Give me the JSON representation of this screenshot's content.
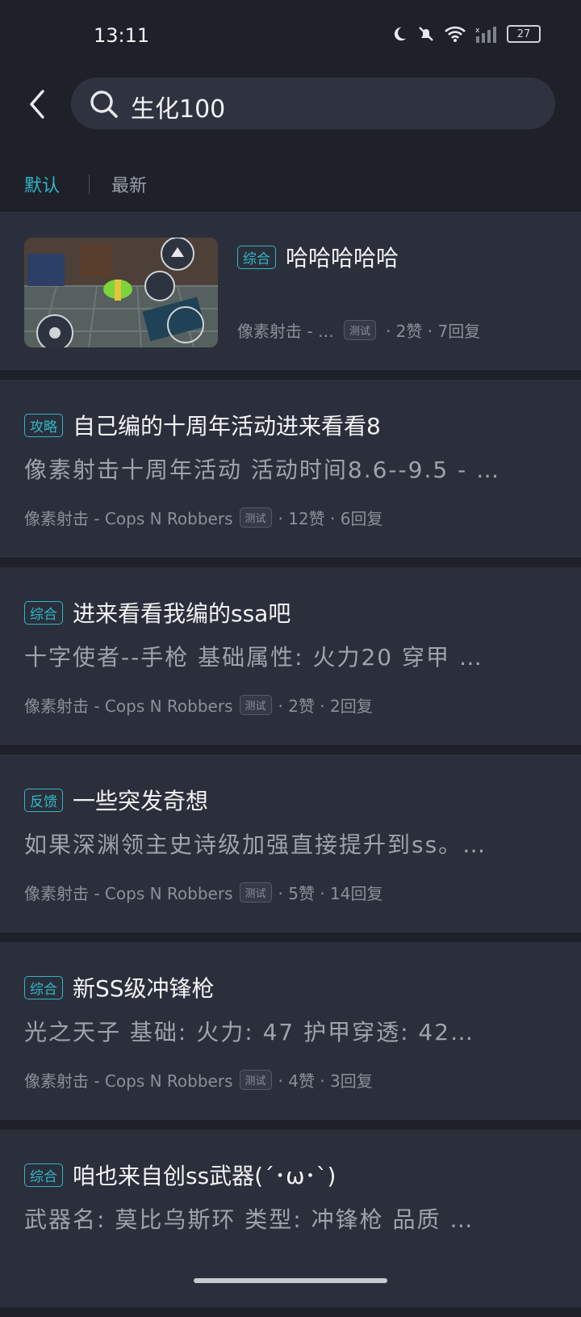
{
  "status": {
    "time": "13:11",
    "battery": "27"
  },
  "search": {
    "query": "生化100"
  },
  "tabs": [
    {
      "label": "默认",
      "active": true
    },
    {
      "label": "最新",
      "active": false
    }
  ],
  "colors": {
    "accent": "#2fb7c7",
    "background": "#1e2129",
    "card": "#2b2f3b"
  },
  "posts": [
    {
      "tag": "综合",
      "title": "哈哈哈哈哈",
      "game": "像素射击 - …",
      "badge": "测试",
      "stats": "· 2赞 · 7回复"
    },
    {
      "tag": "攻略",
      "title": "自己编的十周年活动进来看看8",
      "excerpt": "像素射击十周年活动 活动时间8.6--9.5 - …",
      "game": "像素射击 - Cops N Robbers",
      "badge": "测试",
      "stats": "· 12赞 · 6回复"
    },
    {
      "tag": "综合",
      "title": "进来看看我编的ssa吧",
      "excerpt": "十字使者--手枪 基础属性: 火力20 穿甲 …",
      "game": "像素射击 - Cops N Robbers",
      "badge": "测试",
      "stats": "· 2赞 · 2回复"
    },
    {
      "tag": "反馈",
      "title": "一些突发奇想",
      "excerpt": "如果深渊领主史诗级加强直接提升到ss。…",
      "game": "像素射击 - Cops N Robbers",
      "badge": "测试",
      "stats": "· 5赞 · 14回复"
    },
    {
      "tag": "综合",
      "title": "新SS级冲锋枪",
      "excerpt": "光之天子 基础: 火力: 47 护甲穿透: 42…",
      "game": "像素射击 - Cops N Robbers",
      "badge": "测试",
      "stats": "· 4赞 · 3回复"
    },
    {
      "tag": "综合",
      "title": "咱也来自创ss武器(´･ω･`)",
      "excerpt": "武器名: 莫比乌斯环 类型: 冲锋枪 品质 …"
    }
  ]
}
